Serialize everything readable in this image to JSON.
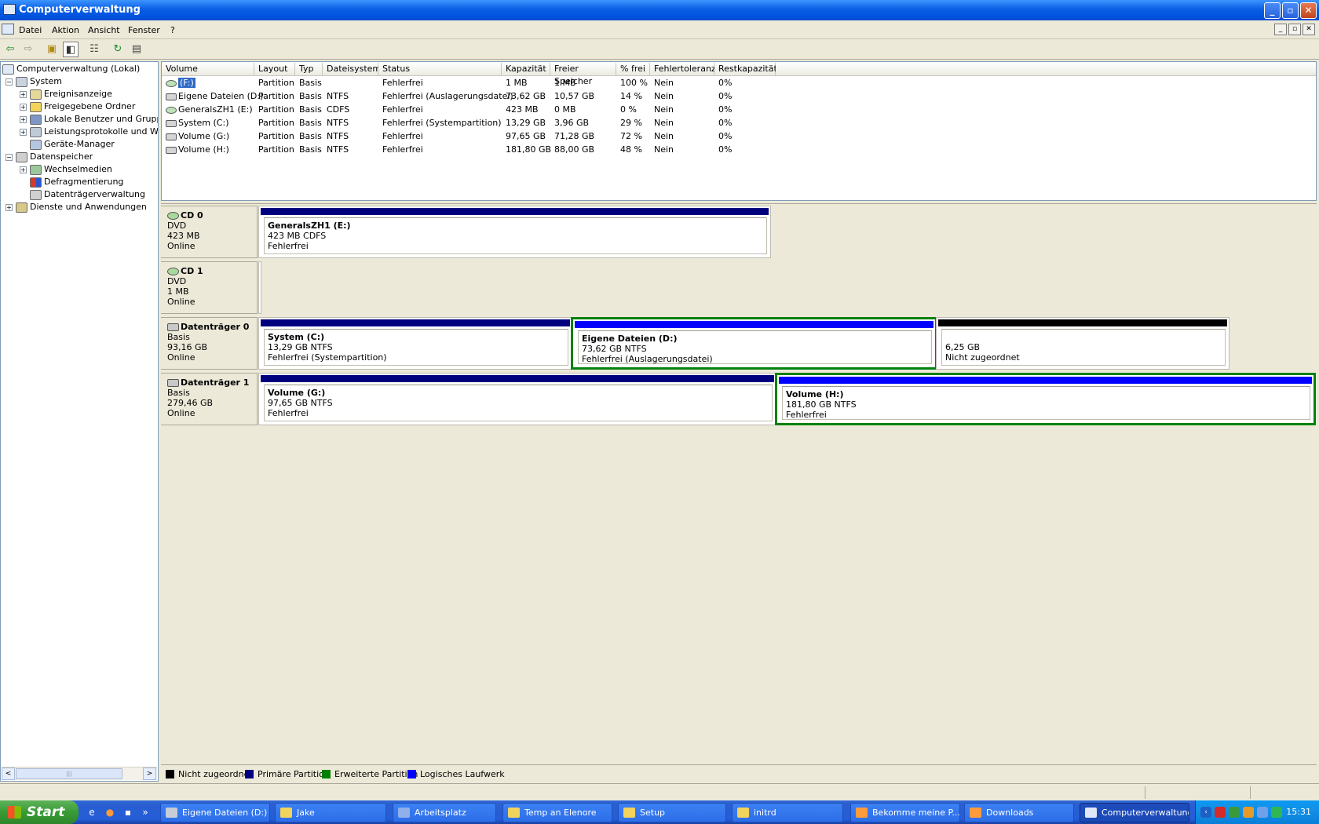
{
  "window": {
    "title": "Computerverwaltung",
    "controls": {
      "minimize": "_",
      "maximize": "▫",
      "close": "✕"
    }
  },
  "menu": {
    "items": [
      "Datei",
      "Aktion",
      "Ansicht",
      "Fenster",
      "?"
    ],
    "mdi_controls": {
      "minimize": "_",
      "restore": "▫",
      "close": "✕"
    }
  },
  "toolbar": {
    "icons": [
      "back-icon",
      "forward-icon",
      "up-folder-icon",
      "show-hide-tree-icon",
      "properties-icon",
      "refresh-icon",
      "help-icon"
    ]
  },
  "tree": {
    "root": "Computerverwaltung (Lokal)",
    "system": "System",
    "system_children": [
      "Ereignisanzeige",
      "Freigegebene Ordner",
      "Lokale Benutzer und Gruppen",
      "Leistungsprotokolle und Warnungen",
      "Geräte-Manager"
    ],
    "storage": "Datenspeicher",
    "storage_children": [
      "Wechselmedien",
      "Defragmentierung",
      "Datenträgerverwaltung"
    ],
    "services": "Dienste und Anwendungen",
    "scroll": {
      "left": "<",
      "thumb": "|||",
      "right": ">"
    }
  },
  "volume_table": {
    "columns": [
      "Volume",
      "Layout",
      "Typ",
      "Dateisystem",
      "Status",
      "Kapazität",
      "Freier Speicher",
      "% frei",
      "Fehlertoleranz",
      "Restkapazität"
    ],
    "rows": [
      [
        "(F:)",
        "Partition",
        "Basis",
        "",
        "Fehlerfrei",
        "1 MB",
        "1 MB",
        "100 %",
        "Nein",
        "0%"
      ],
      [
        "Eigene Dateien (D:)",
        "Partition",
        "Basis",
        "NTFS",
        "Fehlerfrei (Auslagerungsdatei)",
        "73,62 GB",
        "10,57 GB",
        "14 %",
        "Nein",
        "0%"
      ],
      [
        "GeneralsZH1 (E:)",
        "Partition",
        "Basis",
        "CDFS",
        "Fehlerfrei",
        "423 MB",
        "0 MB",
        "0 %",
        "Nein",
        "0%"
      ],
      [
        "System (C:)",
        "Partition",
        "Basis",
        "NTFS",
        "Fehlerfrei (Systempartition)",
        "13,29 GB",
        "3,96 GB",
        "29 %",
        "Nein",
        "0%"
      ],
      [
        "Volume (G:)",
        "Partition",
        "Basis",
        "NTFS",
        "Fehlerfrei",
        "97,65 GB",
        "71,28 GB",
        "72 %",
        "Nein",
        "0%"
      ],
      [
        "Volume (H:)",
        "Partition",
        "Basis",
        "NTFS",
        "Fehlerfrei",
        "181,80 GB",
        "88,00 GB",
        "48 %",
        "Nein",
        "0%"
      ]
    ]
  },
  "disks": [
    {
      "name": "CD 0",
      "type": "DVD",
      "size": "423 MB",
      "state": "Online",
      "partitions": [
        {
          "title": "GeneralsZH1  (E:)",
          "line2": "423 MB CDFS",
          "line3": "Fehlerfrei"
        }
      ]
    },
    {
      "name": "CD 1",
      "type": "DVD",
      "size": "1 MB",
      "state": "Online",
      "partitions": []
    },
    {
      "name": "Datenträger 0",
      "type": "Basis",
      "size": "93,16 GB",
      "state": "Online",
      "partitions": [
        {
          "title": "System  (C:)",
          "line2": "13,29 GB NTFS",
          "line3": "Fehlerfrei (Systempartition)"
        },
        {
          "title": "Eigene Dateien  (D:)",
          "line2": "73,62 GB NTFS",
          "line3": "Fehlerfrei (Auslagerungsdatei)"
        },
        {
          "title": "",
          "line2": "6,25 GB",
          "line3": "Nicht zugeordnet"
        }
      ]
    },
    {
      "name": "Datenträger 1",
      "type": "Basis",
      "size": "279,46 GB",
      "state": "Online",
      "partitions": [
        {
          "title": "Volume  (G:)",
          "line2": "97,65 GB NTFS",
          "line3": "Fehlerfrei"
        },
        {
          "title": "Volume  (H:)",
          "line2": "181,80 GB NTFS",
          "line3": "Fehlerfrei"
        }
      ]
    }
  ],
  "legend": [
    {
      "label": "Nicht zugeordnet",
      "color": "#000000"
    },
    {
      "label": "Primäre Partition",
      "color": "#00007f"
    },
    {
      "label": "Erweiterte Partition",
      "color": "#008000"
    },
    {
      "label": "Logisches Laufwerk",
      "color": "#0000ff"
    }
  ],
  "taskbar": {
    "start_label": "Start",
    "quicklaunch_more": "»",
    "tasks": [
      "Eigene Dateien (D:)",
      "Jake",
      "Arbeitsplatz",
      "Temp an Elenore",
      "Setup",
      "initrd",
      "Bekomme meine P...",
      "Downloads",
      "Computerverwaltung"
    ],
    "tray_toggle": "‹",
    "clock": "15:31"
  },
  "colors": {
    "primary_partition": "#00007f",
    "logical_drive": "#0000ff",
    "unallocated": "#000000",
    "selection_border": "#00820f",
    "titlebar": "#0a5fe3",
    "taskbar": "#245dd7"
  }
}
